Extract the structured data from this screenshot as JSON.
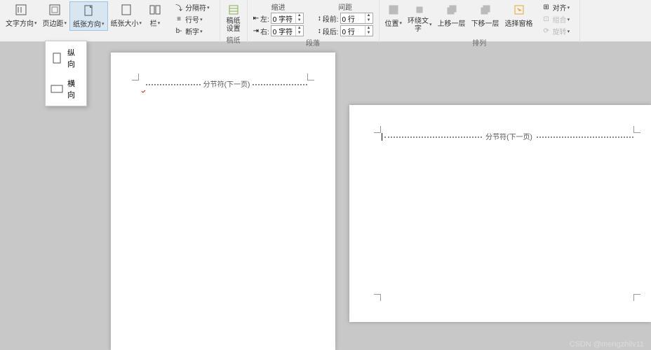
{
  "ribbon": {
    "groups": {
      "page_setup": {
        "text_direction": "文字方向",
        "margins": "页边距",
        "orientation": "纸张方向",
        "size": "纸张大小",
        "columns": "栏",
        "breaks": "分隔符",
        "line_numbers": "行号",
        "hyphenation": "断字"
      },
      "paper": {
        "setting": "稿纸\n设置",
        "label": "稿纸"
      },
      "indent": {
        "header": "缩进",
        "left_label": "左:",
        "right_label": "右:",
        "left_value": "0 字符",
        "right_value": "0 字符"
      },
      "spacing": {
        "header": "间距",
        "before_label": "段前:",
        "after_label": "段后:",
        "before_value": "0 行",
        "after_value": "0 行"
      },
      "paragraph_label": "段落",
      "arrange": {
        "position": "位置",
        "wrap": "环绕文\n字",
        "bring_forward": "上移一层",
        "send_backward": "下移一层",
        "selection_pane": "选择窗格",
        "align": "对齐",
        "group": "组合",
        "rotate": "旋转",
        "label": "排列"
      }
    }
  },
  "dropdown": {
    "portrait": "纵向",
    "landscape": "横向"
  },
  "pages": {
    "section_break_text": "分节符(下一页)"
  },
  "watermark": "CSDN @mengzhilv11"
}
